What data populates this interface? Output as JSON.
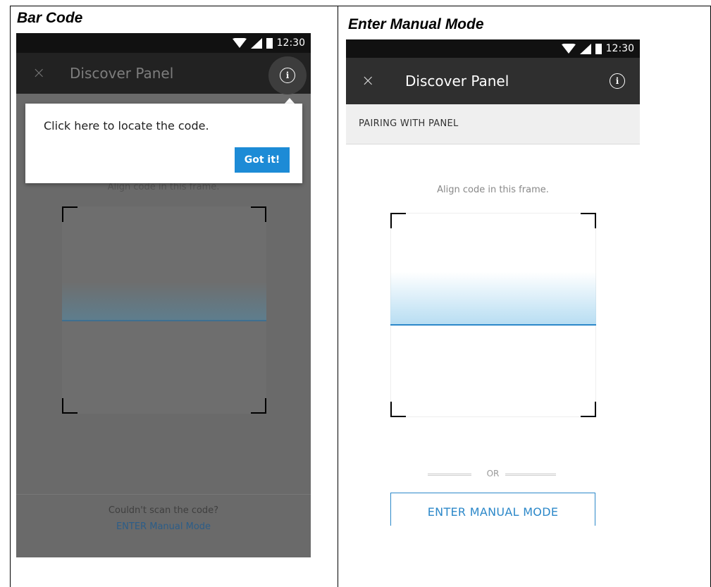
{
  "left_panel": {
    "heading": "Bar Code",
    "status_time": "12:30",
    "app_bar_title": "Discover Panel",
    "close_glyph": "×",
    "info_glyph": "i",
    "tooltip_text": "Click here to locate the code.",
    "tooltip_button": "Got it!",
    "align_text": "Align code in this frame.",
    "bottom_question": "Couldn't scan the code?",
    "bottom_link": "ENTER Manual Mode"
  },
  "right_panel": {
    "heading": "Enter Manual Mode",
    "status_time": "12:30",
    "app_bar_title": "Discover Panel",
    "close_glyph": "×",
    "info_glyph": "i",
    "section_label": "PAIRING WITH PANEL",
    "align_text": "Align code in this frame.",
    "or_text": "OR",
    "manual_button": "ENTER MANUAL MODE"
  },
  "colors": {
    "accent": "#2c88c9",
    "button_blue": "#1d8bd6",
    "status_bar": "#111111",
    "app_bar": "#2f2f2f"
  },
  "icons": [
    "wifi-icon",
    "signal-icon",
    "battery-icon",
    "close-icon",
    "info-icon"
  ]
}
